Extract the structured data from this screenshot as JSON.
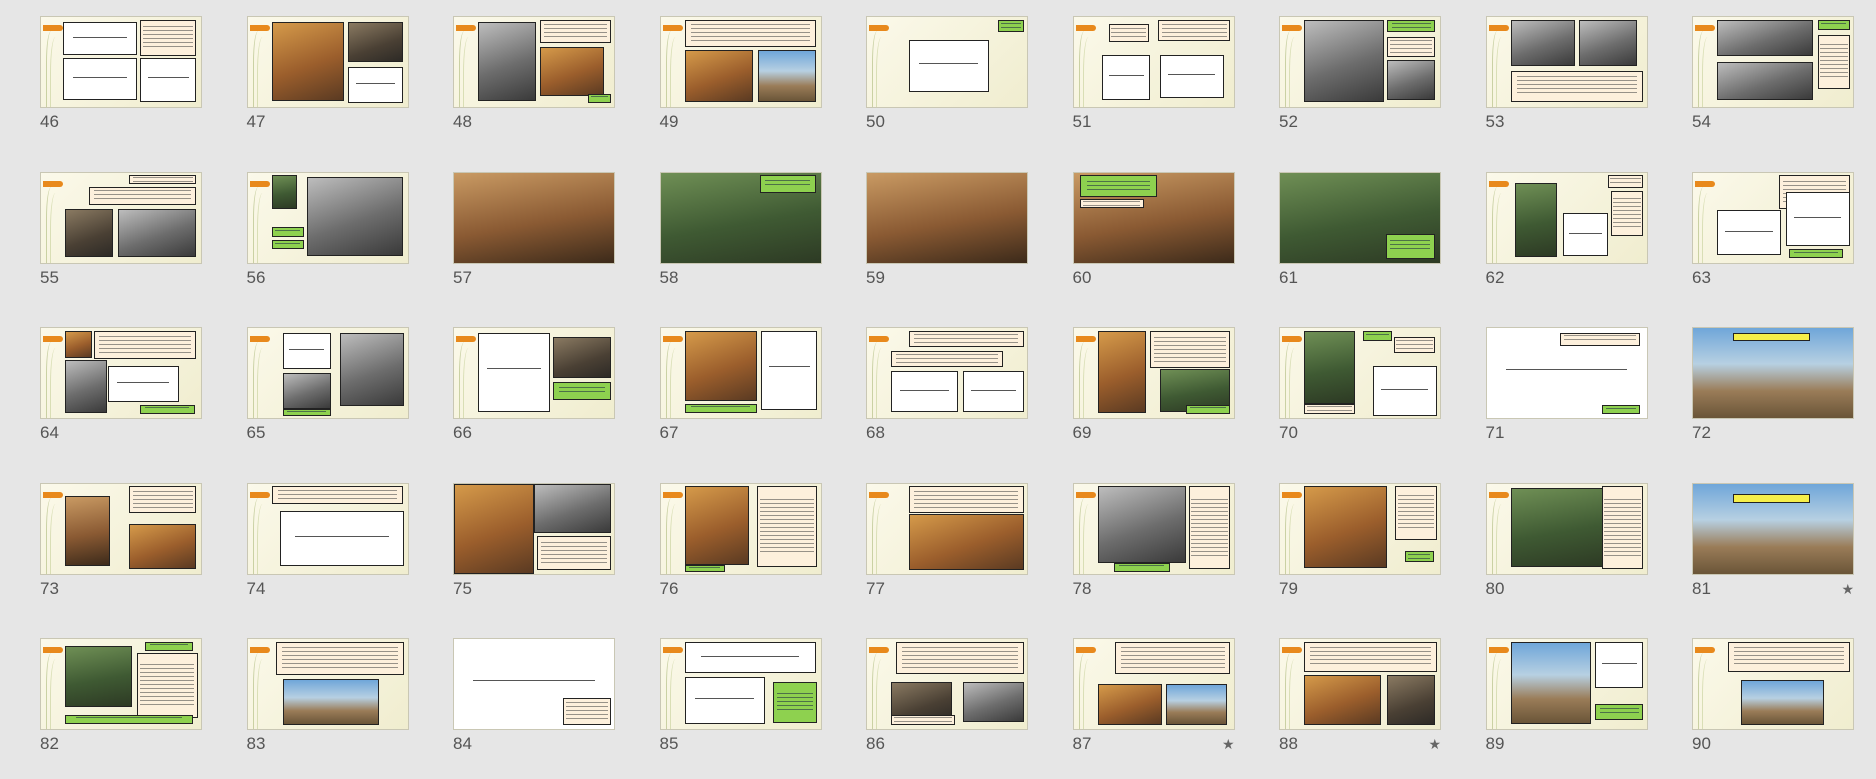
{
  "app": {
    "view": "slide-sorter"
  },
  "slides": [
    {
      "number": "46",
      "layout": "a"
    },
    {
      "number": "47",
      "layout": "b"
    },
    {
      "number": "48",
      "layout": "c"
    },
    {
      "number": "49",
      "layout": "d"
    },
    {
      "number": "50",
      "layout": "e"
    },
    {
      "number": "51",
      "layout": "f"
    },
    {
      "number": "52",
      "layout": "g"
    },
    {
      "number": "53",
      "layout": "h"
    },
    {
      "number": "54",
      "layout": "i"
    },
    {
      "number": "55",
      "layout": "j"
    },
    {
      "number": "56",
      "layout": "k"
    },
    {
      "number": "57",
      "layout": "photo-full"
    },
    {
      "number": "58",
      "layout": "l"
    },
    {
      "number": "59",
      "layout": "photo-full"
    },
    {
      "number": "60",
      "layout": "m"
    },
    {
      "number": "61",
      "layout": "n"
    },
    {
      "number": "62",
      "layout": "o"
    },
    {
      "number": "63",
      "layout": "p"
    },
    {
      "number": "64",
      "layout": "q"
    },
    {
      "number": "65",
      "layout": "r"
    },
    {
      "number": "66",
      "layout": "s"
    },
    {
      "number": "67",
      "layout": "t"
    },
    {
      "number": "68",
      "layout": "u"
    },
    {
      "number": "69",
      "layout": "v"
    },
    {
      "number": "70",
      "layout": "w"
    },
    {
      "number": "71",
      "layout": "x"
    },
    {
      "number": "72",
      "layout": "title-sky"
    },
    {
      "number": "73",
      "layout": "y"
    },
    {
      "number": "74",
      "layout": "z"
    },
    {
      "number": "75",
      "layout": "aa"
    },
    {
      "number": "76",
      "layout": "ab"
    },
    {
      "number": "77",
      "layout": "ac"
    },
    {
      "number": "78",
      "layout": "ad"
    },
    {
      "number": "79",
      "layout": "ae"
    },
    {
      "number": "80",
      "layout": "af"
    },
    {
      "number": "81",
      "layout": "title-photo",
      "starred": true
    },
    {
      "number": "82",
      "layout": "ag"
    },
    {
      "number": "83",
      "layout": "ah"
    },
    {
      "number": "84",
      "layout": "plan-full"
    },
    {
      "number": "85",
      "layout": "ai"
    },
    {
      "number": "86",
      "layout": "aj"
    },
    {
      "number": "87",
      "layout": "ak",
      "starred": true
    },
    {
      "number": "88",
      "layout": "al",
      "starred": true
    },
    {
      "number": "89",
      "layout": "am"
    },
    {
      "number": "90",
      "layout": "an"
    }
  ],
  "icons": {
    "animation_marker": "star-icon"
  },
  "star_glyph": "★",
  "colors": {
    "accent": "#e8891c",
    "note": "#8ed14f",
    "title_highlight": "#f6ef4a",
    "background": "#e6e6e6"
  }
}
